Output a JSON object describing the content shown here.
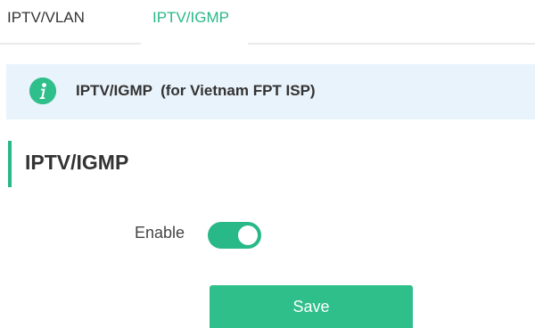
{
  "tabs": [
    {
      "label": "IPTV/VLAN",
      "active": false
    },
    {
      "label": "IPTV/IGMP",
      "active": true
    }
  ],
  "notice": {
    "icon": "info-icon",
    "text": "IPTV/IGMP  (for Vietnam FPT ISP)"
  },
  "section": {
    "title": "IPTV/IGMP"
  },
  "form": {
    "enable_label": "Enable",
    "enable_value": true
  },
  "actions": {
    "save_label": "Save"
  },
  "colors": {
    "accent": "#29b888",
    "notice_bg": "#e9f3fb"
  }
}
